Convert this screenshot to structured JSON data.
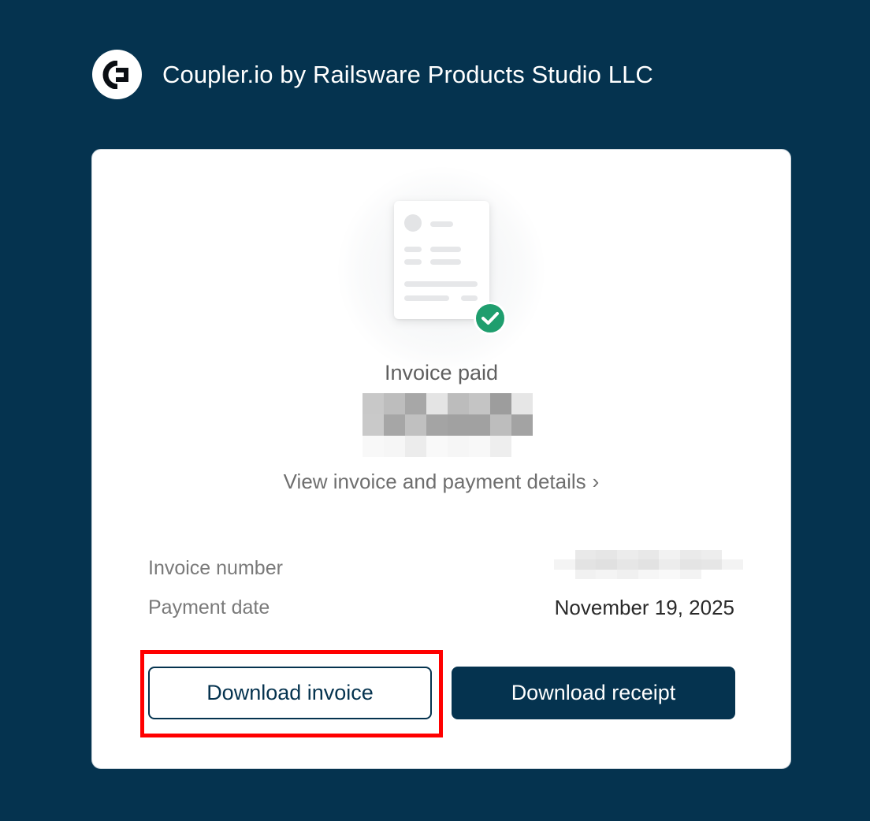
{
  "header": {
    "company_name": "Coupler.io by Railsware Products Studio LLC",
    "logo_icon": "coupler-logo-icon"
  },
  "invoice": {
    "status": "Invoice paid",
    "status_icon": "check-circle-icon",
    "status_color": "#1f9e6e",
    "amount": "[redacted]",
    "details_link": "View invoice and payment details",
    "details_link_icon": "chevron-right-icon",
    "rows": [
      {
        "label": "Invoice number",
        "value": "[redacted]"
      },
      {
        "label": "Payment date",
        "value": "November 19, 2025"
      }
    ]
  },
  "actions": {
    "download_invoice": "Download invoice",
    "download_receipt": "Download receipt"
  },
  "colors": {
    "background": "#05334f",
    "card": "#ffffff",
    "primary_button": "#05334f",
    "highlight_outline": "#ff0000"
  }
}
